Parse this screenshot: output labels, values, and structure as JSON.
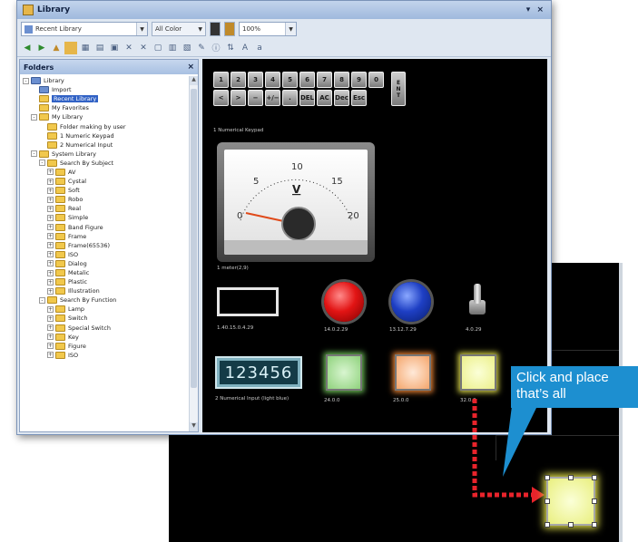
{
  "window": {
    "title": "Library",
    "controls": "▾ ×"
  },
  "toolbar": {
    "library_select": "Recent Library",
    "color_select": "All Color",
    "zoom_select": "100%"
  },
  "folders_panel": {
    "title": "Folders",
    "close": "×",
    "tree": [
      {
        "label": "Library",
        "exp": "-",
        "indent": 0,
        "icon": "blue"
      },
      {
        "label": "Import",
        "exp": "",
        "indent": 1,
        "icon": "blue"
      },
      {
        "label": "Recent Library",
        "exp": "",
        "indent": 1,
        "icon": "yellow",
        "selected": true
      },
      {
        "label": "My Favorites",
        "exp": "",
        "indent": 1,
        "icon": "yellow"
      },
      {
        "label": "My Library",
        "exp": "-",
        "indent": 1,
        "icon": "yellow"
      },
      {
        "label": "Folder making by user",
        "exp": "",
        "indent": 2,
        "icon": "yellow"
      },
      {
        "label": "1 Numeric Keypad",
        "exp": "",
        "indent": 2,
        "icon": "yellow"
      },
      {
        "label": "2 Numerical Input",
        "exp": "",
        "indent": 2,
        "icon": "yellow"
      },
      {
        "label": "System Library",
        "exp": "-",
        "indent": 1,
        "icon": "yellow"
      },
      {
        "label": "Search By Subject",
        "exp": "-",
        "indent": 2,
        "icon": "yellow"
      },
      {
        "label": "AV",
        "exp": "+",
        "indent": 3,
        "icon": "yellow"
      },
      {
        "label": "Cystal",
        "exp": "+",
        "indent": 3,
        "icon": "yellow"
      },
      {
        "label": "Soft",
        "exp": "+",
        "indent": 3,
        "icon": "yellow"
      },
      {
        "label": "Robo",
        "exp": "+",
        "indent": 3,
        "icon": "yellow"
      },
      {
        "label": "Real",
        "exp": "+",
        "indent": 3,
        "icon": "yellow"
      },
      {
        "label": "Simple",
        "exp": "+",
        "indent": 3,
        "icon": "yellow"
      },
      {
        "label": "Band Figure",
        "exp": "+",
        "indent": 3,
        "icon": "yellow"
      },
      {
        "label": "Frame",
        "exp": "+",
        "indent": 3,
        "icon": "yellow"
      },
      {
        "label": "Frame(65536)",
        "exp": "+",
        "indent": 3,
        "icon": "yellow"
      },
      {
        "label": "ISO",
        "exp": "+",
        "indent": 3,
        "icon": "yellow"
      },
      {
        "label": "Dialog",
        "exp": "+",
        "indent": 3,
        "icon": "yellow"
      },
      {
        "label": "Metalic",
        "exp": "+",
        "indent": 3,
        "icon": "yellow"
      },
      {
        "label": "Plastic",
        "exp": "+",
        "indent": 3,
        "icon": "yellow"
      },
      {
        "label": "Illustration",
        "exp": "+",
        "indent": 3,
        "icon": "yellow"
      },
      {
        "label": "Search By Function",
        "exp": "-",
        "indent": 2,
        "icon": "yellow"
      },
      {
        "label": "Lamp",
        "exp": "+",
        "indent": 3,
        "icon": "yellow"
      },
      {
        "label": "Switch",
        "exp": "+",
        "indent": 3,
        "icon": "yellow"
      },
      {
        "label": "Special Switch",
        "exp": "+",
        "indent": 3,
        "icon": "yellow"
      },
      {
        "label": "Key",
        "exp": "+",
        "indent": 3,
        "icon": "yellow"
      },
      {
        "label": "Figure",
        "exp": "+",
        "indent": 3,
        "icon": "yellow"
      },
      {
        "label": "ISO",
        "exp": "+",
        "indent": 3,
        "icon": "yellow"
      }
    ]
  },
  "parts": {
    "keypad_keys": [
      "1",
      "2",
      "3",
      "4",
      "5",
      "6",
      "7",
      "8",
      "9",
      "0",
      "<",
      ">",
      "−",
      "+/−",
      ".",
      "DEL",
      "AC",
      "Dec",
      "Esc"
    ],
    "keypad_enter": [
      "E",
      "N",
      "T"
    ],
    "keypad_caption": "1 Numerical Keypad",
    "meter": {
      "ticks": [
        "0",
        "5",
        "10",
        "15",
        "20"
      ],
      "unit": "V",
      "caption": "1 meter(2,9)"
    },
    "frame_caption": "1.40.15.0.4.29",
    "red_lamp_caption": "14.0.2.29",
    "blue_lamp_caption": "13.12.7.29",
    "toggle_caption": "4.0.29",
    "numeric_value": "123456",
    "numeric_caption": "2 Numerical Input (light blue)",
    "green_caption": "24.0.0",
    "orange_caption": "25.0.0",
    "yellow_caption": "32.0.0"
  },
  "callout": {
    "line1": "Click and place",
    "line2": "that’s all"
  },
  "colors": {
    "accent": "#1d8fd0",
    "arrow": "#e8232b"
  }
}
